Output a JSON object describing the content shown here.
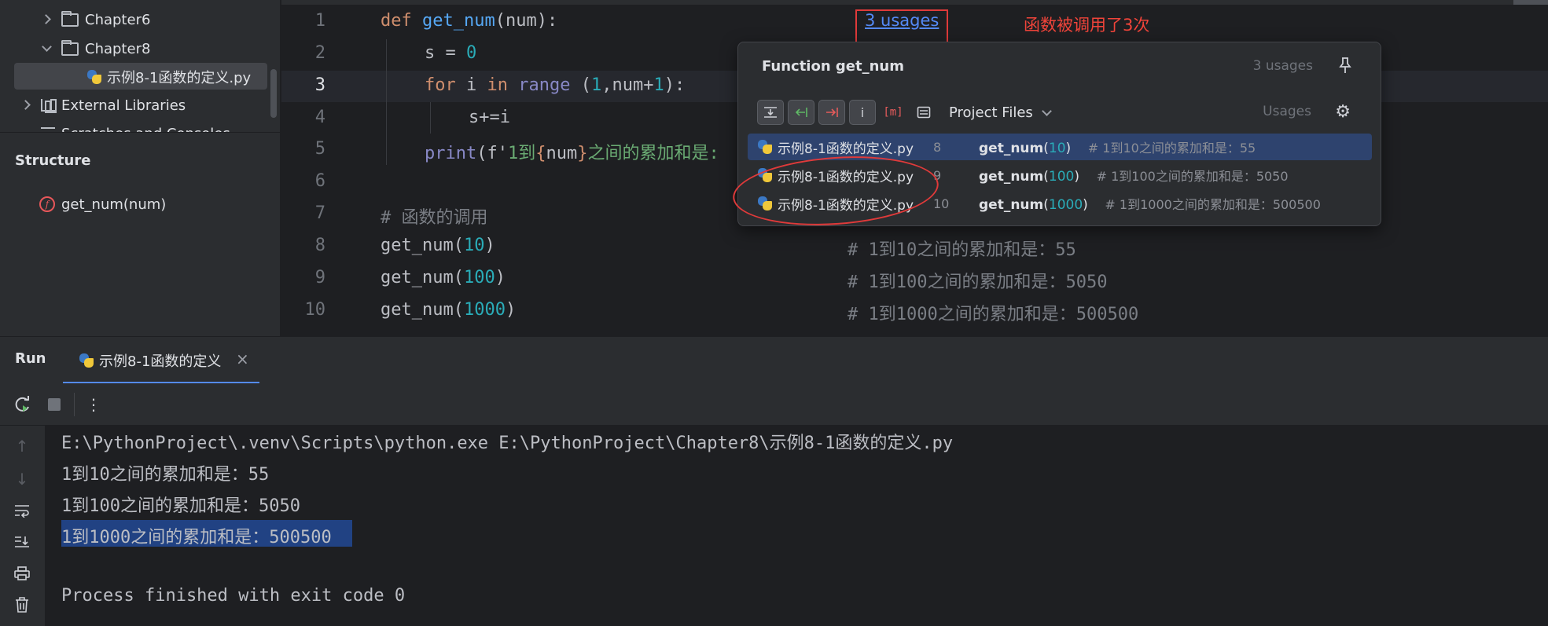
{
  "project_tree": {
    "items": [
      {
        "label": "Chapter6",
        "type": "folder",
        "expanded": false
      },
      {
        "label": "Chapter8",
        "type": "folder",
        "expanded": true
      },
      {
        "label": "示例8-1函数的定义.py",
        "type": "python-file",
        "selected": true
      },
      {
        "label": "External Libraries",
        "type": "library",
        "expanded": false
      },
      {
        "label": "Scratches and Consoles",
        "type": "scratch"
      }
    ]
  },
  "structure": {
    "title": "Structure",
    "function_badge": "f",
    "item": "get_num(num)"
  },
  "editor": {
    "line_numbers": [
      "1",
      "2",
      "3",
      "4",
      "5",
      "6",
      "7",
      "8",
      "9",
      "10"
    ],
    "current_line": "3",
    "lines": {
      "l1": {
        "kw": "def",
        "name": "get_num",
        "sig": "(num):"
      },
      "l2": {
        "lhs": "s = ",
        "val": "0"
      },
      "l3": {
        "kw1": "for",
        "var": " i ",
        "kw2": "in",
        "builtin": "range",
        "p1": " (",
        "n1": "1",
        "mid": ",num+",
        "n2": "1",
        "p2": "):"
      },
      "l4": {
        "text": "s+=i"
      },
      "l5": {
        "builtin": "print",
        "p1": "(f'",
        "s1": "1到",
        "b1": "{",
        "var": "num",
        "b2": "}",
        "s2": "之间的累加和是:"
      },
      "l7": {
        "comment": "# 函数的调用"
      },
      "l8": {
        "call": "get_num(",
        "arg": "10",
        "close": ")",
        "comment": "# 1到10之间的累加和是：55"
      },
      "l9": {
        "call": "get_num(",
        "arg": "100",
        "close": ")",
        "comment": "# 1到100之间的累加和是：5050"
      },
      "l10": {
        "call": "get_num(",
        "arg": "1000",
        "close": ")",
        "comment": "# 1到1000之间的累加和是：500500"
      }
    },
    "usages_link": "3 usages",
    "annotation": "函数被调用了3次"
  },
  "popup": {
    "title": "Function get_num",
    "count": "3 usages",
    "scope": "Project Files",
    "usages_label": "Usages",
    "toolbar_m": "[m]",
    "toolbar_i": "i",
    "rows": [
      {
        "file": "示例8-1函数的定义.py",
        "line": "8",
        "call": "get_num",
        "open": "(",
        "arg": "10",
        "close": ")",
        "comment": "# 1到10之间的累加和是：55",
        "selected": true
      },
      {
        "file": "示例8-1函数的定义.py",
        "line": "9",
        "call": "get_num",
        "open": "(",
        "arg": "100",
        "close": ")",
        "comment": "# 1到100之间的累加和是：5050",
        "selected": false
      },
      {
        "file": "示例8-1函数的定义.py",
        "line": "10",
        "call": "get_num",
        "open": "(",
        "arg": "1000",
        "close": ")",
        "comment": "# 1到1000之间的累加和是：500500",
        "selected": false
      }
    ]
  },
  "run": {
    "title": "Run",
    "tab_label": "示例8-1函数的定义",
    "close_glyph": "×",
    "console": [
      "E:\\PythonProject\\.venv\\Scripts\\python.exe E:\\PythonProject\\Chapter8\\示例8-1函数的定义.py",
      "1到10之间的累加和是：55",
      "1到100之间的累加和是：5050",
      "1到1000之间的累加和是：500500",
      "",
      "Process finished with exit code 0"
    ]
  },
  "colors": {
    "accent": "#548af7",
    "annotation_red": "#e03a3a",
    "selection": "#214283"
  }
}
